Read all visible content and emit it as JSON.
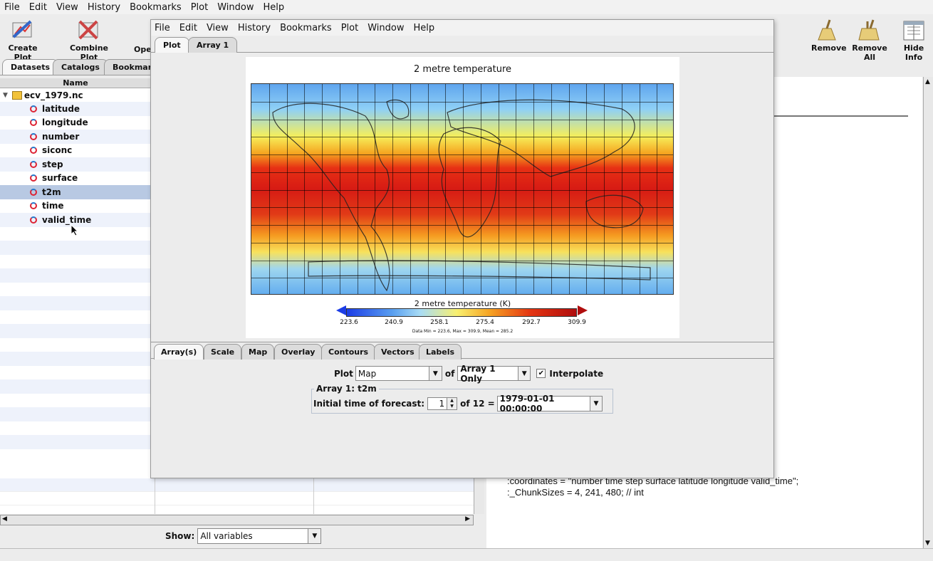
{
  "main_menu": [
    "File",
    "Edit",
    "View",
    "History",
    "Bookmarks",
    "Plot",
    "Window",
    "Help"
  ],
  "toolbar": {
    "create_plot": "Create Plot",
    "combine_plot": "Combine Plot",
    "open_partial": "Ope",
    "remove": "Remove",
    "remove_all": "Remove All",
    "hide_info": "Hide Info"
  },
  "left_tabs": [
    "Datasets",
    "Catalogs",
    "Bookmark"
  ],
  "tree": {
    "header": "Name",
    "dataset": "ecv_1979.nc",
    "variables": [
      "latitude",
      "longitude",
      "number",
      "siconc",
      "step",
      "surface",
      "t2m",
      "time",
      "valid_time"
    ],
    "selected": "t2m"
  },
  "show": {
    "label": "Show:",
    "value": "All variables"
  },
  "info_lines": [
    ":coordinates = \"number time step surface latitude longitude valid_time\";",
    ":_ChunkSizes = 4, 241, 480; // int"
  ],
  "plot_window": {
    "menu": [
      "File",
      "Edit",
      "View",
      "History",
      "Bookmarks",
      "Plot",
      "Window",
      "Help"
    ],
    "tabs": [
      "Plot",
      "Array 1"
    ],
    "plot": {
      "title": "2 metre temperature",
      "colorbar_label": "2 metre temperature (K)",
      "ticks": [
        "223.6",
        "240.9",
        "258.1",
        "275.4",
        "292.7",
        "309.9"
      ],
      "stats": "Data Min = 223.6, Max = 309.9, Mean = 285.2",
      "colors": {
        "low": "#1c3de6",
        "high": "#b00d0d"
      }
    },
    "bottom_tabs": [
      "Array(s)",
      "Scale",
      "Map",
      "Overlay",
      "Contours",
      "Vectors",
      "Labels"
    ],
    "controls": {
      "plot_label": "Plot",
      "plot_type": "Map",
      "of_label": "of",
      "arrays": "Array 1 Only",
      "interpolate_label": "Interpolate",
      "interpolate_checked": true,
      "group_title": "Array 1: t2m",
      "forecast_label": "Initial time of forecast:",
      "forecast_index": "1",
      "forecast_count": "of 12 =",
      "forecast_value": "1979-01-01 00:00:00"
    }
  }
}
